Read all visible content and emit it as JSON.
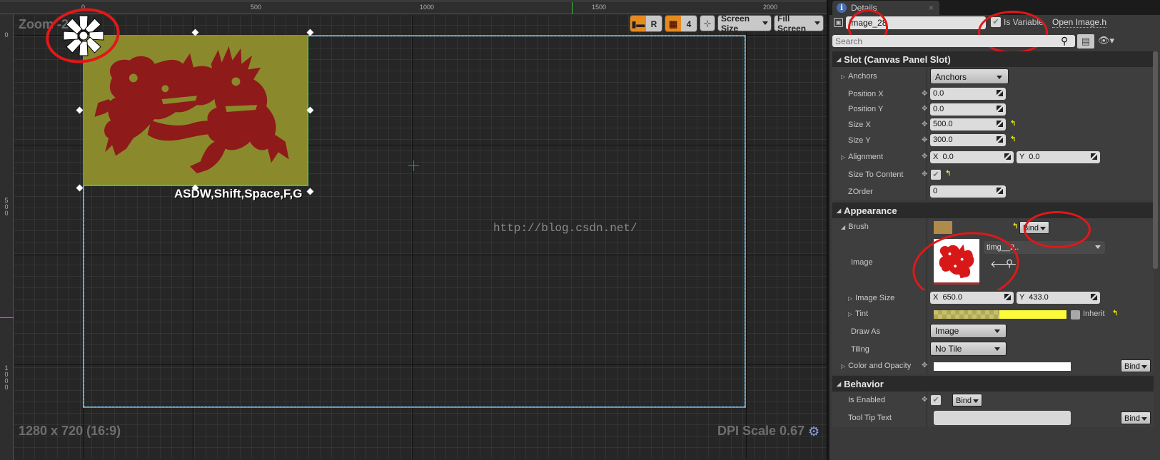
{
  "viewport": {
    "zoom_label": "Zoom -2",
    "resolution_label": "1280 x 720 (16:9)",
    "dpi_label": "DPI Scale 0.67",
    "hint_text": "ASDW,Shift,Space,F,G",
    "watermark": "http://blog.csdn.net/",
    "ruler_top_labels": [
      "0",
      "500",
      "1000",
      "1500",
      "2000"
    ],
    "ruler_left_labels": [
      "0",
      "500",
      "1000"
    ],
    "toolbar": {
      "r_label": "R",
      "grid_snap_value": "4",
      "screen_size_label": "Screen Size",
      "fill_screen_label": "Fill Screen"
    },
    "icons": {
      "flower": "flower-cursor-icon",
      "dpi_settings": "gear-icon"
    }
  },
  "details": {
    "tab_label": "Details",
    "widget_name": "Image_28",
    "is_variable_label": "Is Variable",
    "is_variable_checked": true,
    "open_link": "Open Image.h",
    "search_placeholder": "Search",
    "sections": {
      "slot": {
        "title": "Slot (Canvas Panel Slot)",
        "anchors_label": "Anchors",
        "anchors_value": "Anchors",
        "position_x_label": "Position X",
        "position_x": "0.0",
        "position_y_label": "Position Y",
        "position_y": "0.0",
        "size_x_label": "Size X",
        "size_x": "500.0",
        "size_y_label": "Size Y",
        "size_y": "300.0",
        "alignment_label": "Alignment",
        "alignment_x": "X  0.0",
        "alignment_y": "Y  0.0",
        "size_to_content_label": "Size To Content",
        "size_to_content_checked": true,
        "zorder_label": "ZOrder",
        "zorder": "0"
      },
      "appearance": {
        "title": "Appearance",
        "brush_label": "Brush",
        "bind_label": "Bind",
        "image_label": "Image",
        "image_asset": "timg__2..",
        "image_size_label": "Image Size",
        "image_size_x": "X  650.0",
        "image_size_y": "Y  433.0",
        "tint_label": "Tint",
        "tint_color": "#FBFB3C",
        "inherit_label": "Inherit",
        "draw_as_label": "Draw As",
        "draw_as": "Image",
        "tiling_label": "Tiling",
        "tiling": "No Tile",
        "color_opacity_label": "Color and Opacity",
        "color_opacity_color": "#FFFFFF"
      },
      "behavior": {
        "title": "Behavior",
        "is_enabled_label": "Is Enabled",
        "is_enabled_checked": true,
        "tooltip_label": "Tool Tip Text",
        "tooltip_value": ""
      }
    }
  }
}
